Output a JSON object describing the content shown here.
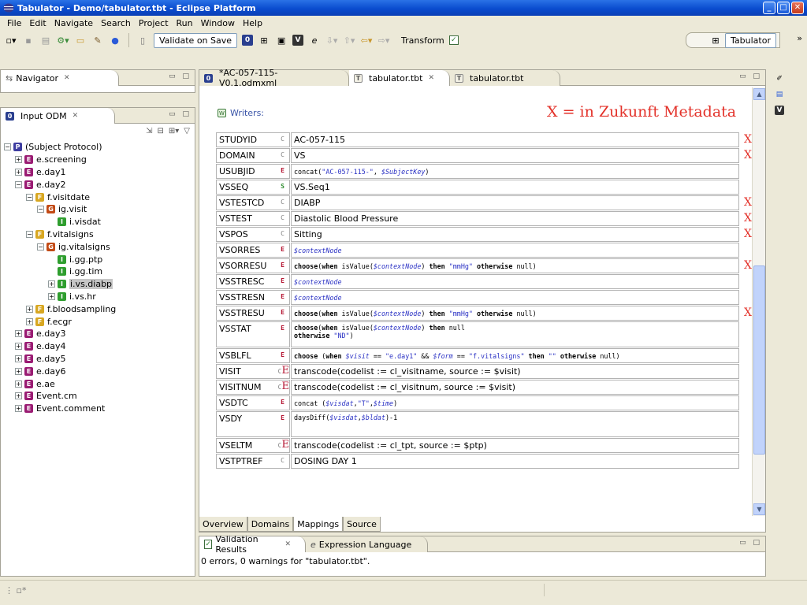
{
  "window": {
    "title": "Tabulator - Demo/tabulator.tbt - Eclipse Platform"
  },
  "menu": [
    "File",
    "Edit",
    "Navigate",
    "Search",
    "Project",
    "Run",
    "Window",
    "Help"
  ],
  "toolbar": {
    "validate_label": "Validate on Save",
    "transform_label": "Transform",
    "perspective_label": "Tabulator"
  },
  "navigator": {
    "tab_label": "Navigator"
  },
  "odm": {
    "tab_label": "Input ODM",
    "tree": [
      {
        "label": "(Subject Protocol)",
        "icon": "P",
        "depth": 0,
        "exp": "-"
      },
      {
        "label": "e.screening",
        "icon": "E",
        "depth": 1,
        "exp": "+"
      },
      {
        "label": "e.day1",
        "icon": "E",
        "depth": 1,
        "exp": "+"
      },
      {
        "label": "e.day2",
        "icon": "E",
        "depth": 1,
        "exp": "-"
      },
      {
        "label": "f.visitdate",
        "icon": "F",
        "depth": 2,
        "exp": "-"
      },
      {
        "label": "ig.visit",
        "icon": "G",
        "depth": 3,
        "exp": "-"
      },
      {
        "label": "i.visdat",
        "icon": "I",
        "depth": 4,
        "exp": ""
      },
      {
        "label": "f.vitalsigns",
        "icon": "F",
        "depth": 2,
        "exp": "-"
      },
      {
        "label": "ig.vitalsigns",
        "icon": "G",
        "depth": 3,
        "exp": "-"
      },
      {
        "label": "i.gg.ptp",
        "icon": "I",
        "depth": 4,
        "exp": ""
      },
      {
        "label": "i.gg.tim",
        "icon": "I",
        "depth": 4,
        "exp": ""
      },
      {
        "label": "i.vs.diabp",
        "icon": "I",
        "depth": 4,
        "exp": "+",
        "selected": true
      },
      {
        "label": "i.vs.hr",
        "icon": "I",
        "depth": 4,
        "exp": "+"
      },
      {
        "label": "f.bloodsampling",
        "icon": "F",
        "depth": 2,
        "exp": "+"
      },
      {
        "label": "f.ecgr",
        "icon": "F",
        "depth": 2,
        "exp": "+"
      },
      {
        "label": "e.day3",
        "icon": "E",
        "depth": 1,
        "exp": "+"
      },
      {
        "label": "e.day4",
        "icon": "E",
        "depth": 1,
        "exp": "+"
      },
      {
        "label": "e.day5",
        "icon": "E",
        "depth": 1,
        "exp": "+"
      },
      {
        "label": "e.day6",
        "icon": "E",
        "depth": 1,
        "exp": "+"
      },
      {
        "label": "e.ae",
        "icon": "E",
        "depth": 1,
        "exp": "+"
      },
      {
        "label": "Event.cm",
        "icon": "E",
        "depth": 1,
        "exp": "+"
      },
      {
        "label": "Event.comment",
        "icon": "E",
        "depth": 1,
        "exp": "+"
      }
    ]
  },
  "editor": {
    "tabs": [
      {
        "label": "*AC-057-115-V0.1.odmxml",
        "active": false
      },
      {
        "label": "tabulator.tbt",
        "active": true
      },
      {
        "label": "tabulator.tbt",
        "active": false
      }
    ],
    "writers_label": "Writers:",
    "annotation": "X = in Zukunft Metadata",
    "x_mark": "X",
    "rows": [
      {
        "name": "STUDYID",
        "type": "C",
        "value": "AC-057-115",
        "x": true
      },
      {
        "name": "DOMAIN",
        "type": "C",
        "value": "VS",
        "x": true
      },
      {
        "name": "USUBJID",
        "type": "E",
        "parts": [
          [
            "",
            "concat("
          ],
          [
            "str",
            "\"AC-057-115-\""
          ],
          [
            "",
            ", "
          ],
          [
            "var",
            "$SubjectKey"
          ],
          [
            "",
            ")"
          ]
        ]
      },
      {
        "name": "VSSEQ",
        "type": "S",
        "value": "VS.Seq1"
      },
      {
        "name": "VSTESTCD",
        "type": "C",
        "value": "DIABP",
        "x": true
      },
      {
        "name": "VSTEST",
        "type": "C",
        "value": "Diastolic Blood Pressure",
        "x": true
      },
      {
        "name": "VSPOS",
        "type": "C",
        "value": "Sitting",
        "x": true
      },
      {
        "name": "VSORRES",
        "type": "E",
        "parts": [
          [
            "var",
            "$contextNode"
          ]
        ]
      },
      {
        "name": "VSORRESU",
        "type": "E",
        "x": true,
        "parts": [
          [
            "kw",
            "choose"
          ],
          [
            "",
            "("
          ],
          [
            "kw",
            "when "
          ],
          [
            "",
            "isValue("
          ],
          [
            "var",
            "$contextNode"
          ],
          [
            "",
            ") "
          ],
          [
            "kw",
            "then "
          ],
          [
            "str",
            "\"mmHg\""
          ],
          [
            "",
            " "
          ],
          [
            "kw",
            "otherwise "
          ],
          [
            "",
            "null)"
          ]
        ]
      },
      {
        "name": "VSSTRESC",
        "type": "E",
        "parts": [
          [
            "var",
            "$contextNode"
          ]
        ]
      },
      {
        "name": "VSSTRESN",
        "type": "E",
        "parts": [
          [
            "var",
            "$contextNode"
          ]
        ]
      },
      {
        "name": "VSSTRESU",
        "type": "E",
        "x": true,
        "parts": [
          [
            "kw",
            "choose"
          ],
          [
            "",
            "("
          ],
          [
            "kw",
            "when "
          ],
          [
            "",
            "isValue("
          ],
          [
            "var",
            "$contextNode"
          ],
          [
            "",
            ") "
          ],
          [
            "kw",
            "then "
          ],
          [
            "str",
            "\"mmHg\""
          ],
          [
            "",
            " "
          ],
          [
            "kw",
            "otherwise "
          ],
          [
            "",
            "null)"
          ]
        ]
      },
      {
        "name": "VSSTAT",
        "type": "E",
        "tall": true,
        "parts": [
          [
            "kw",
            "choose"
          ],
          [
            "",
            "("
          ],
          [
            "kw",
            "when "
          ],
          [
            "",
            "isValue("
          ],
          [
            "var",
            "$contextNode"
          ],
          [
            "",
            ") "
          ],
          [
            "kw",
            "then "
          ],
          [
            "",
            "null"
          ]
        ],
        "parts2": [
          [
            "kw",
            "otherwise "
          ],
          [
            "str",
            "\"ND\""
          ],
          [
            "",
            ")"
          ]
        ]
      },
      {
        "name": "VSBLFL",
        "type": "E",
        "parts": [
          [
            "kw",
            "choose "
          ],
          [
            "",
            "("
          ],
          [
            "kw",
            "when "
          ],
          [
            "var",
            "$visit"
          ],
          [
            "",
            " == "
          ],
          [
            "str",
            "\"e.day1\""
          ],
          [
            "",
            " && "
          ],
          [
            "var",
            "$form"
          ],
          [
            "",
            " == "
          ],
          [
            "str",
            "\"f.vitalsigns\""
          ],
          [
            "",
            " "
          ],
          [
            "kw",
            "then "
          ],
          [
            "str",
            "\"\""
          ],
          [
            "",
            " "
          ],
          [
            "kw",
            "otherwise "
          ],
          [
            "",
            "null)"
          ]
        ]
      },
      {
        "name": "VISIT",
        "type": "CE",
        "value": "transcode(codelist := cl_visitname, source := $visit)"
      },
      {
        "name": "VISITNUM",
        "type": "CE",
        "value": "transcode(codelist := cl_visitnum, source := $visit)"
      },
      {
        "name": "VSDTC",
        "type": "E",
        "parts": [
          [
            "",
            "concat ("
          ],
          [
            "var",
            "$visdat"
          ],
          [
            "",
            ","
          ],
          [
            "str",
            "\"T\""
          ],
          [
            "",
            ","
          ],
          [
            "var",
            "$time"
          ],
          [
            "",
            ")"
          ]
        ]
      },
      {
        "name": "VSDY",
        "type": "E",
        "tall": true,
        "parts": [
          [
            "",
            "daysDiff("
          ],
          [
            "var",
            "$visdat"
          ],
          [
            "",
            ","
          ],
          [
            "var",
            "$bldat"
          ],
          [
            "",
            ")-1"
          ]
        ]
      },
      {
        "name": "VSELTM",
        "type": "CE",
        "value": "transcode(codelist := cl_tpt, source := $ptp)"
      },
      {
        "name": "VSTPTREF",
        "type": "C",
        "value": "DOSING DAY 1"
      }
    ],
    "bottom_tabs": [
      {
        "label": "Overview",
        "active": false
      },
      {
        "label": "Domains",
        "active": false
      },
      {
        "label": "Mappings",
        "active": true
      },
      {
        "label": "Source",
        "active": false
      }
    ]
  },
  "validation": {
    "tab_label": "Validation Results",
    "tab2_label": "Expression Language",
    "message": "0 errors, 0 warnings for \"tabulator.tbt\"."
  },
  "colors": {
    "annotation": "#e3322a",
    "titlebar": "#0a4ccf"
  }
}
